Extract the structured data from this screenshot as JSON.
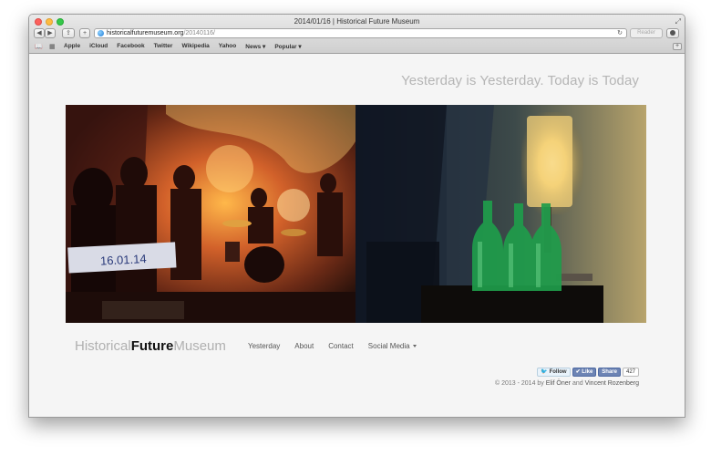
{
  "browser": {
    "window_title": "2014/01/16 | Historical Future Museum",
    "url_host": "historicalfuturemuseum.org",
    "url_path": "/20140116/",
    "reader_label": "Reader",
    "reload_icon": "reload-icon",
    "bookmarks": [
      "Apple",
      "iCloud",
      "Facebook",
      "Twitter",
      "Wikipedia",
      "Yahoo",
      "News ▾",
      "Popular ▾"
    ]
  },
  "page": {
    "tagline": "Yesterday is Yesterday. Today is Today",
    "logo": {
      "part1": "Historical",
      "part2": "Future",
      "part3": "Museum"
    },
    "nav": [
      "Yesterday",
      "About",
      "Contact",
      "Social Media"
    ],
    "social": {
      "twitter_label": "Follow",
      "like_label": "Like",
      "share_label": "Share",
      "share_count": "427"
    },
    "copyright": {
      "prefix": "© 2013 - 2014 by ",
      "author1": "Elif Öner",
      "and": " and ",
      "author2": "Vincent Rozenberg"
    },
    "photo": {
      "handwritten_note": "16.01.14"
    }
  },
  "colors": {
    "page_bg": "#f5f5f5",
    "tagline": "#b5b5b5",
    "facebook": "#6d84b4",
    "twitter": "#2aa9e0"
  }
}
